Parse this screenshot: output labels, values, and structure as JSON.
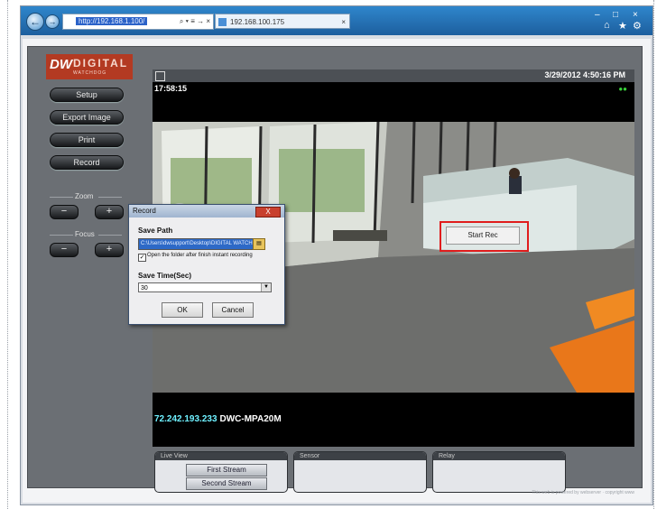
{
  "browser": {
    "address_url": "http://192.168.1.100/",
    "address_tools": "⌕ ▾ ≡ → ×",
    "tab_label": "192.168.100.175",
    "tab_close": "×",
    "window_controls": [
      "–",
      "□",
      "×"
    ],
    "toolbar_icons": [
      "⌂",
      "★",
      "⚙"
    ]
  },
  "logo": {
    "mark": "DW",
    "name": "DIGITAL",
    "sub": "WATCHDOG"
  },
  "sidebar": {
    "buttons": [
      "Setup",
      "Export Image",
      "Print",
      "Record"
    ],
    "zoom_label": "Zoom",
    "focus_label": "Focus",
    "minus": "−",
    "plus": "+"
  },
  "video": {
    "datetime": "3/29/2012  4:50:16 PM",
    "timestamp": "17:58:15",
    "rec_indicator": "●●",
    "ip": "72.242.193.233",
    "model": "DWC-MPA20M"
  },
  "context_menu": {
    "item": "Start Rec"
  },
  "dialog": {
    "title": "Record",
    "close": "X",
    "save_path_label": "Save Path",
    "save_path_value": "C:\\Users\\dwsupport\\Desktop\\DIGITAL WATCHDOG\\",
    "folder_icon": "▤",
    "checkbox_checked": "✓",
    "checkbox_label": "Open the folder after finish instant recording",
    "save_time_label": "Save Time(Sec)",
    "save_time_value": "30",
    "ok": "OK",
    "cancel": "Cancel"
  },
  "panels": {
    "live_view": {
      "title": "Live View",
      "buttons": [
        "First Stream",
        "Second Stream"
      ]
    },
    "sensor": {
      "title": "Sensor"
    },
    "relay": {
      "title": "Relay"
    }
  },
  "footnote": "This web is powered by webserver · copyright  www"
}
